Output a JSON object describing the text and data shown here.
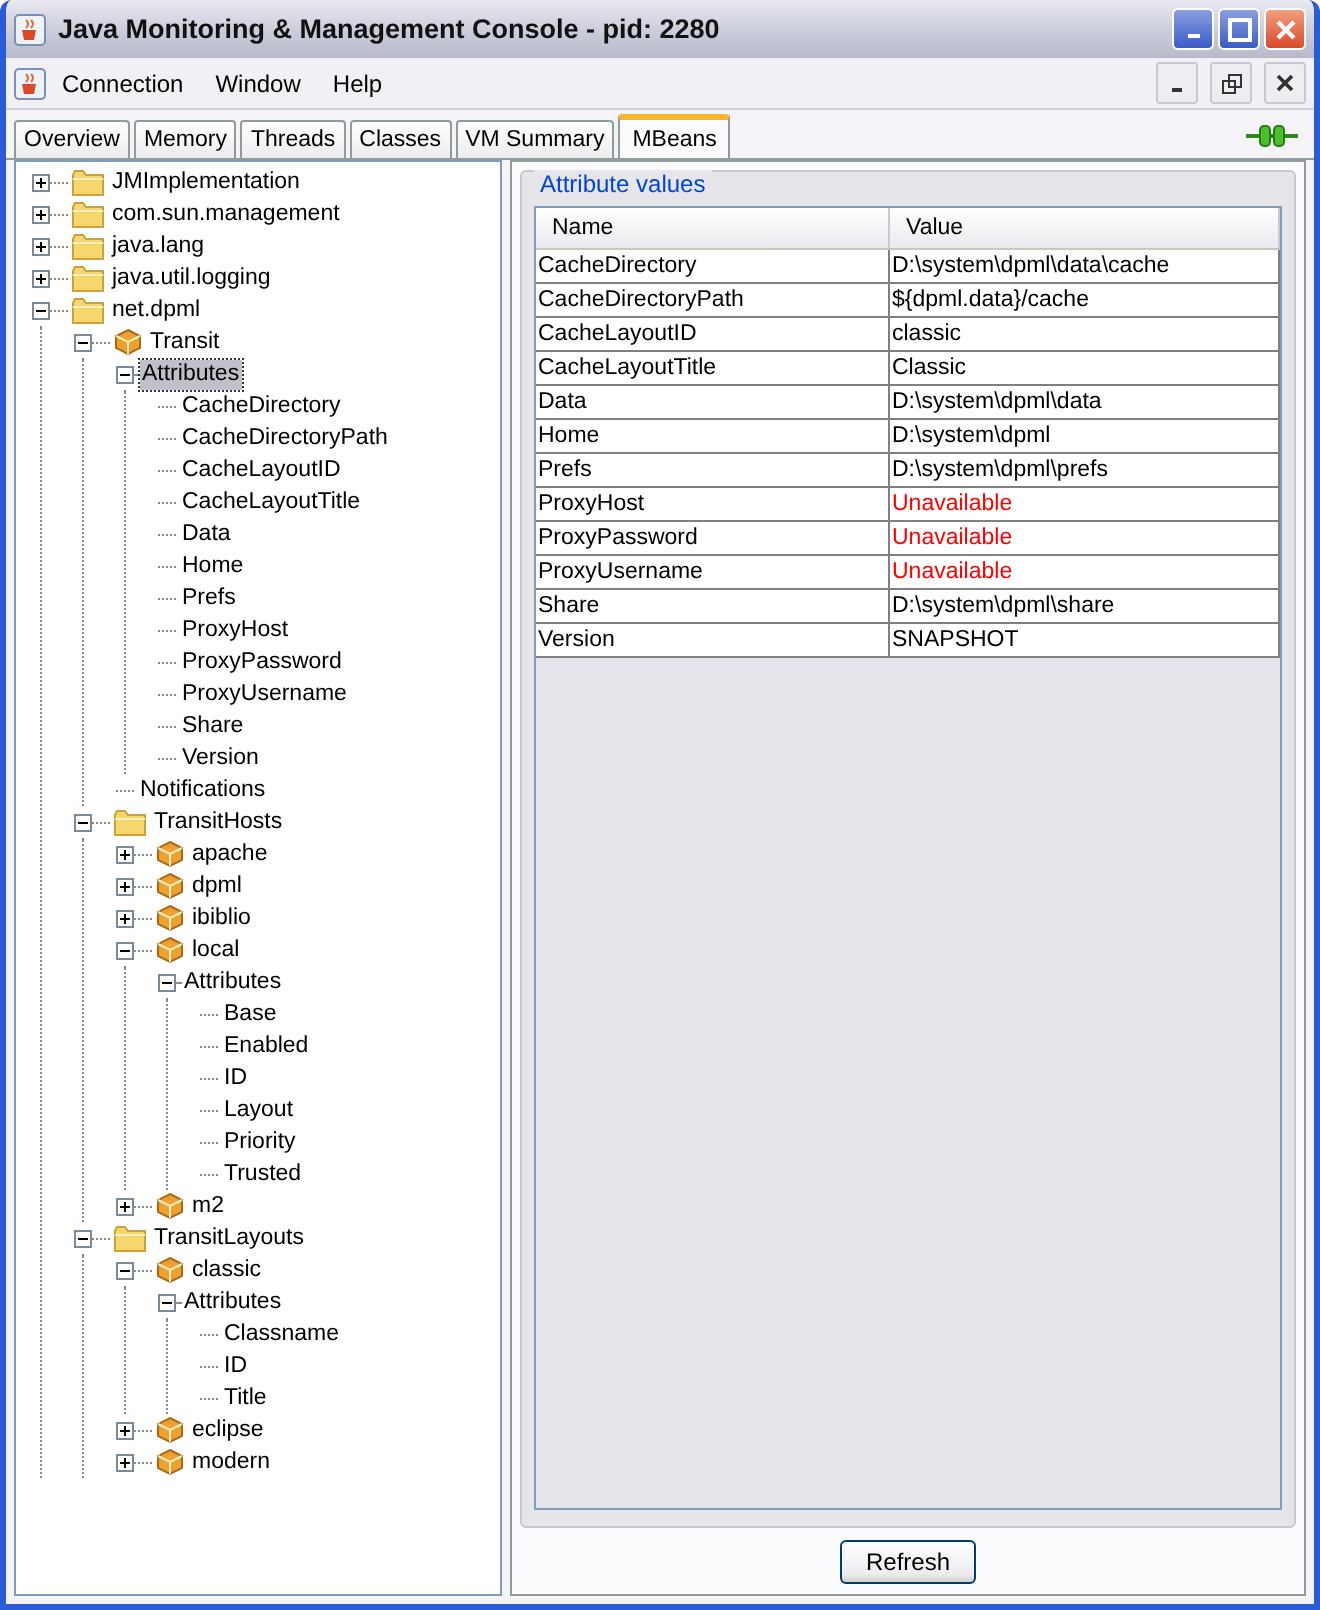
{
  "window": {
    "title": "Java Monitoring & Management Console - pid: 2280"
  },
  "menu": [
    "Connection",
    "Window",
    "Help"
  ],
  "tabs": [
    {
      "label": "Overview",
      "selected": false
    },
    {
      "label": "Memory",
      "selected": false
    },
    {
      "label": "Threads",
      "selected": false
    },
    {
      "label": "Classes",
      "selected": false
    },
    {
      "label": "VM Summary",
      "selected": false
    },
    {
      "label": "MBeans",
      "selected": true
    }
  ],
  "tree": [
    {
      "label": "JMImplementation",
      "kind": "folder",
      "expanded": false,
      "selected": false
    },
    {
      "label": "com.sun.management",
      "kind": "folder",
      "expanded": false,
      "selected": false
    },
    {
      "label": "java.lang",
      "kind": "folder",
      "expanded": false,
      "selected": false
    },
    {
      "label": "java.util.logging",
      "kind": "folder",
      "expanded": false,
      "selected": false
    },
    {
      "label": "net.dpml",
      "kind": "folder",
      "expanded": true,
      "selected": false,
      "children": [
        {
          "label": "Transit",
          "kind": "bean",
          "expanded": true,
          "selected": false,
          "children": [
            {
              "label": "Attributes",
              "kind": "group",
              "expanded": true,
              "selected": true,
              "children": [
                {
                  "label": "CacheDirectory",
                  "kind": "leaf",
                  "selected": false
                },
                {
                  "label": "CacheDirectoryPath",
                  "kind": "leaf",
                  "selected": false
                },
                {
                  "label": "CacheLayoutID",
                  "kind": "leaf",
                  "selected": false
                },
                {
                  "label": "CacheLayoutTitle",
                  "kind": "leaf",
                  "selected": false
                },
                {
                  "label": "Data",
                  "kind": "leaf",
                  "selected": false
                },
                {
                  "label": "Home",
                  "kind": "leaf",
                  "selected": false
                },
                {
                  "label": "Prefs",
                  "kind": "leaf",
                  "selected": false
                },
                {
                  "label": "ProxyHost",
                  "kind": "leaf",
                  "selected": false
                },
                {
                  "label": "ProxyPassword",
                  "kind": "leaf",
                  "selected": false
                },
                {
                  "label": "ProxyUsername",
                  "kind": "leaf",
                  "selected": false
                },
                {
                  "label": "Share",
                  "kind": "leaf",
                  "selected": false
                },
                {
                  "label": "Version",
                  "kind": "leaf",
                  "selected": false
                }
              ]
            },
            {
              "label": "Notifications",
              "kind": "leaf",
              "selected": false
            }
          ]
        },
        {
          "label": "TransitHosts",
          "kind": "folder",
          "expanded": true,
          "selected": false,
          "children": [
            {
              "label": "apache",
              "kind": "bean",
              "expanded": false,
              "selected": false
            },
            {
              "label": "dpml",
              "kind": "bean",
              "expanded": false,
              "selected": false
            },
            {
              "label": "ibiblio",
              "kind": "bean",
              "expanded": false,
              "selected": false
            },
            {
              "label": "local",
              "kind": "bean",
              "expanded": true,
              "selected": false,
              "children": [
                {
                  "label": "Attributes",
                  "kind": "group",
                  "expanded": true,
                  "selected": false,
                  "children": [
                    {
                      "label": "Base",
                      "kind": "leaf",
                      "selected": false
                    },
                    {
                      "label": "Enabled",
                      "kind": "leaf",
                      "selected": false
                    },
                    {
                      "label": "ID",
                      "kind": "leaf",
                      "selected": false
                    },
                    {
                      "label": "Layout",
                      "kind": "leaf",
                      "selected": false
                    },
                    {
                      "label": "Priority",
                      "kind": "leaf",
                      "selected": false
                    },
                    {
                      "label": "Trusted",
                      "kind": "leaf",
                      "selected": false
                    }
                  ]
                }
              ]
            },
            {
              "label": "m2",
              "kind": "bean",
              "expanded": false,
              "selected": false
            }
          ]
        },
        {
          "label": "TransitLayouts",
          "kind": "folder",
          "expanded": true,
          "selected": false,
          "children": [
            {
              "label": "classic",
              "kind": "bean",
              "expanded": true,
              "selected": false,
              "children": [
                {
                  "label": "Attributes",
                  "kind": "group",
                  "expanded": true,
                  "selected": false,
                  "children": [
                    {
                      "label": "Classname",
                      "kind": "leaf",
                      "selected": false
                    },
                    {
                      "label": "ID",
                      "kind": "leaf",
                      "selected": false
                    },
                    {
                      "label": "Title",
                      "kind": "leaf",
                      "selected": false
                    }
                  ]
                }
              ]
            },
            {
              "label": "eclipse",
              "kind": "bean",
              "expanded": false,
              "selected": false
            },
            {
              "label": "modern",
              "kind": "bean",
              "expanded": false,
              "selected": false
            }
          ]
        }
      ]
    }
  ],
  "attributes": {
    "title": "Attribute values",
    "columns": [
      "Name",
      "Value"
    ],
    "rows": [
      {
        "name": "CacheDirectory",
        "value": "D:\\system\\dpml\\data\\cache",
        "error": false
      },
      {
        "name": "CacheDirectoryPath",
        "value": "${dpml.data}/cache",
        "error": false
      },
      {
        "name": "CacheLayoutID",
        "value": "classic",
        "error": false
      },
      {
        "name": "CacheLayoutTitle",
        "value": "Classic",
        "error": false
      },
      {
        "name": "Data",
        "value": "D:\\system\\dpml\\data",
        "error": false
      },
      {
        "name": "Home",
        "value": "D:\\system\\dpml",
        "error": false
      },
      {
        "name": "Prefs",
        "value": "D:\\system\\dpml\\prefs",
        "error": false
      },
      {
        "name": "ProxyHost",
        "value": "Unavailable",
        "error": true
      },
      {
        "name": "ProxyPassword",
        "value": "Unavailable",
        "error": true
      },
      {
        "name": "ProxyUsername",
        "value": "Unavailable",
        "error": true
      },
      {
        "name": "Share",
        "value": "D:\\system\\dpml\\share",
        "error": false
      },
      {
        "name": "Version",
        "value": "SNAPSHOT",
        "error": false
      }
    ]
  },
  "buttons": [
    "Refresh"
  ]
}
